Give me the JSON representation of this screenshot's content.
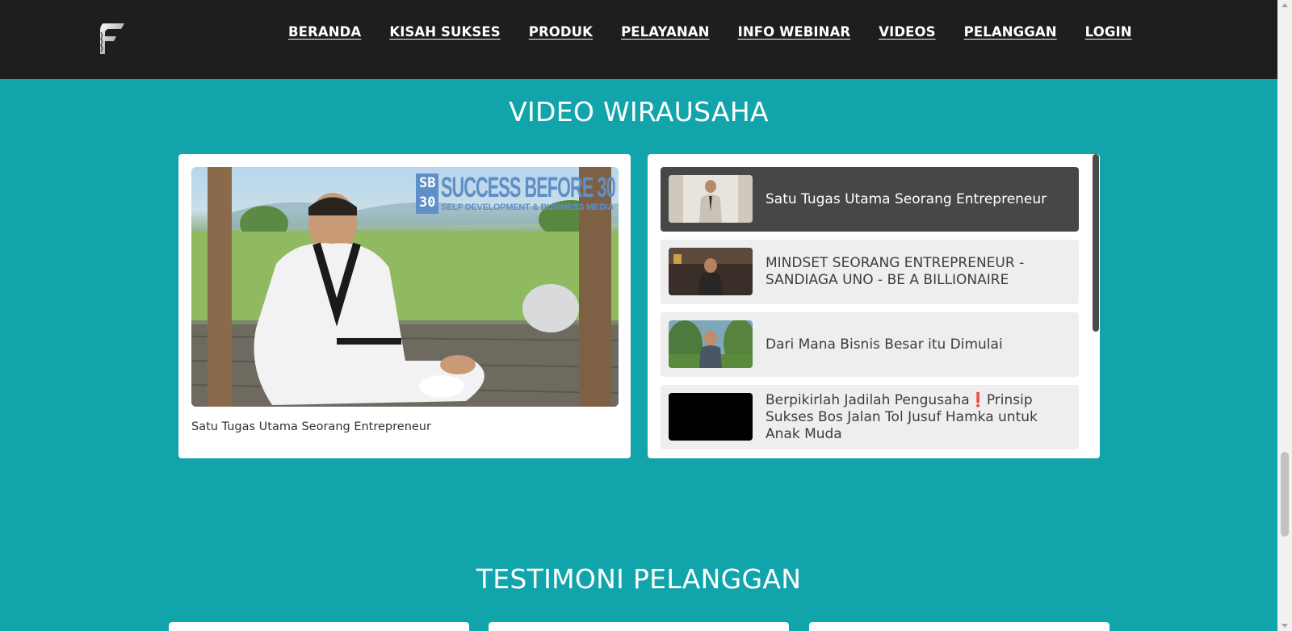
{
  "nav": {
    "logo_icon": "f-logo-icon",
    "items": [
      "BERANDA",
      "KISAH SUKSES",
      "PRODUK",
      "PELAYANAN",
      "INFO WEBINAR",
      "VIDEOS",
      "PELANGGAN",
      "LOGIN"
    ]
  },
  "video_section": {
    "title": "VIDEO WIRAUSAHA",
    "main_video": {
      "overlay_badge": "SB 30",
      "overlay_title": "SUCCESS BEFORE 30",
      "overlay_subtitle": "SELF DEVELOPMENT & BUSINESS MEDIA",
      "caption": "Satu Tugas Utama Seorang Entrepreneur"
    },
    "playlist": [
      {
        "title": "Satu Tugas Utama Seorang Entrepreneur",
        "active": true
      },
      {
        "title": "MINDSET SEORANG ENTREPRENEUR - SANDIAGA UNO - BE A BILLIONAIRE",
        "active": false
      },
      {
        "title": "Dari Mana Bisnis Besar itu Dimulai",
        "active": false
      },
      {
        "title": "Berpikirlah Jadilah Pengusaha❗Prinsip Sukses Bos Jalan Tol Jusuf Hamka untuk Anak Muda",
        "active": false
      }
    ]
  },
  "testimonial_section": {
    "title": "TESTIMONI PELANGGAN"
  },
  "colors": {
    "header_bg": "#1e1e1e",
    "page_bg": "#11a5ab",
    "active_item_bg": "#474747",
    "item_bg": "#eeeeee",
    "brand_blue": "#5e8fc7"
  }
}
